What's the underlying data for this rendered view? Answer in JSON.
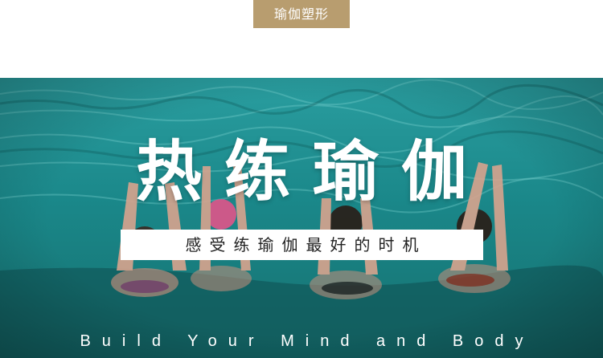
{
  "header": {
    "tag_label": "瑜伽塑形"
  },
  "hero": {
    "title": "热练瑜伽",
    "subtitle": "感受练瑜伽最好的时机",
    "english_tagline": "Build Your Mind and Body"
  },
  "colors": {
    "tag_background": "#b89d6f",
    "pool_water": "#1f8e90",
    "text_white": "#ffffff",
    "subtitle_text": "#222222"
  }
}
